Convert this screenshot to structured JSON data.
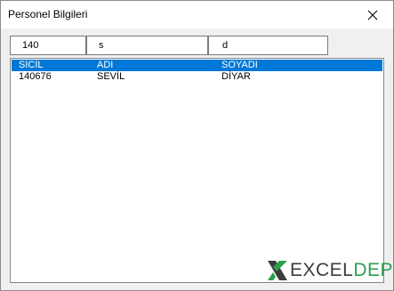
{
  "window": {
    "title": "Personel Bilgileri",
    "close_icon": "close-icon"
  },
  "filters": {
    "sicil_value": "140",
    "adi_value": "s",
    "soyadi_value": "d"
  },
  "list": {
    "columns": [
      "SİCİL",
      "ADI",
      "SOYADI"
    ],
    "rows": [
      [
        "140676",
        "SEVİL",
        "DİYAR"
      ]
    ]
  },
  "branding": {
    "logo_excel": "EXCEL",
    "logo_depo": "DEPO",
    "logo_icon": "x-logo-icon",
    "accent_green": "#2e9e4c",
    "selection_blue": "#0078d7"
  }
}
